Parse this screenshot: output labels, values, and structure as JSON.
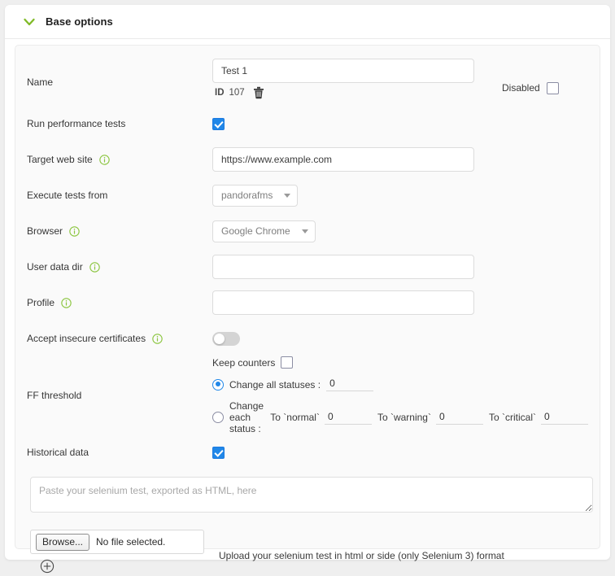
{
  "header": {
    "title": "Base options",
    "chevron_icon": "chevron-down-icon",
    "accent_color": "#80ba27"
  },
  "colors": {
    "accent_green": "#80ba27",
    "checkbox_blue": "#2087e8",
    "panel_bg": "#fafafa",
    "card_bg": "#ffffff",
    "page_bg": "#efefef"
  },
  "fields": {
    "name": {
      "label": "Name",
      "value": "Test 1",
      "placeholder": "",
      "id_key": "ID",
      "id_value": "107",
      "delete_icon": "trash-icon",
      "disabled_label": "Disabled",
      "disabled_checked": false
    },
    "run_performance_tests": {
      "label": "Run performance tests",
      "checked": true
    },
    "target_web_site": {
      "label": "Target web site",
      "value": "https://www.example.com",
      "placeholder": "",
      "has_info": true
    },
    "execute_tests_from": {
      "label": "Execute tests from",
      "value": "pandorafms",
      "options": [
        "pandorafms"
      ],
      "has_info": false
    },
    "browser": {
      "label": "Browser",
      "value": "Google Chrome",
      "options": [
        "Google Chrome"
      ],
      "has_info": true
    },
    "user_data_dir": {
      "label": "User data dir",
      "value": "",
      "placeholder": "",
      "has_info": true
    },
    "profile": {
      "label": "Profile",
      "value": "",
      "placeholder": "",
      "has_info": true
    },
    "accept_insecure_certificates": {
      "label": "Accept insecure certificates",
      "has_info": true,
      "toggle_on": false
    },
    "ff_threshold": {
      "label": "FF threshold",
      "keep_counters_label": "Keep counters",
      "keep_counters_checked": false,
      "all_statuses_label": "Change all statuses :",
      "all_statuses_selected": true,
      "all_statuses_value": "0",
      "each_status_label": "Change each status :",
      "each_status_selected": false,
      "to_normal_label": "To `normal`",
      "to_normal_value": "0",
      "to_warning_label": "To `warning`",
      "to_warning_value": "0",
      "to_critical_label": "To `critical`",
      "to_critical_value": "0"
    },
    "historical_data": {
      "label": "Historical data",
      "checked": true
    }
  },
  "selenium": {
    "textarea_value": "",
    "textarea_placeholder": "Paste your selenium test, exported as HTML, here",
    "browse_button_label": "Browse...",
    "file_name": "No file selected.",
    "add_icon": "plus-circle-icon",
    "upload_hint": "Upload your selenium test in html or side (only Selenium 3) format"
  }
}
